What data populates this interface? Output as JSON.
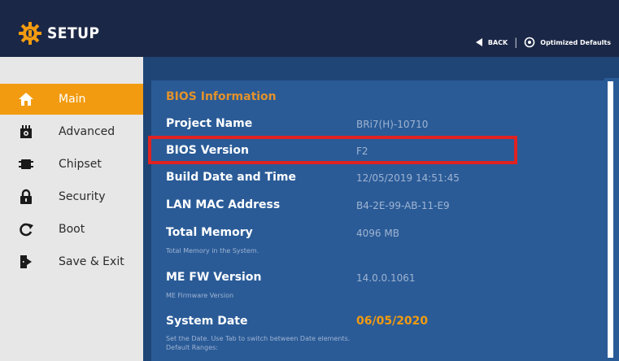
{
  "header": {
    "title": "SETUP",
    "back_label": "BACK",
    "optimized_label": "Optimized Defaults",
    "icon": "gear-icon"
  },
  "sidebar": {
    "items": [
      {
        "label": "Main",
        "icon": "home-icon",
        "active": true
      },
      {
        "label": "Advanced",
        "icon": "chip-gear-icon",
        "active": false
      },
      {
        "label": "Chipset",
        "icon": "chip-icon",
        "active": false
      },
      {
        "label": "Security",
        "icon": "lock-icon",
        "active": false
      },
      {
        "label": "Boot",
        "icon": "refresh-icon",
        "active": false
      },
      {
        "label": "Save & Exit",
        "icon": "exit-door-icon",
        "active": false
      }
    ]
  },
  "main": {
    "section_title": "BIOS Information",
    "rows": [
      {
        "label": "Project Name",
        "value": "BRi7(H)-10710"
      },
      {
        "label": "BIOS Version",
        "value": "F2"
      },
      {
        "label": "Build Date and Time",
        "value": "12/05/2019 14:51:45"
      },
      {
        "label": "LAN MAC Address",
        "value": "B4-2E-99-AB-11-E9"
      },
      {
        "label": "Total Memory",
        "value": "4096 MB",
        "help": "Total Memory in the System."
      },
      {
        "label": "ME FW Version",
        "value": "14.0.0.1061",
        "help": "ME Firmware Version"
      },
      {
        "label": "System Date",
        "value": "06/05/2020",
        "help": "Set the Date. Use Tab to switch between Date elements.",
        "help2": "Default Ranges:"
      }
    ]
  },
  "colors": {
    "header_bg": "#1b2746",
    "sidebar_bg": "#e7e7e7",
    "active_item": "#f29b10",
    "main_bg": "#1e4576",
    "panel_bg": "#2a5b97",
    "section_title": "#e2922b",
    "highlight": "#e02222"
  }
}
